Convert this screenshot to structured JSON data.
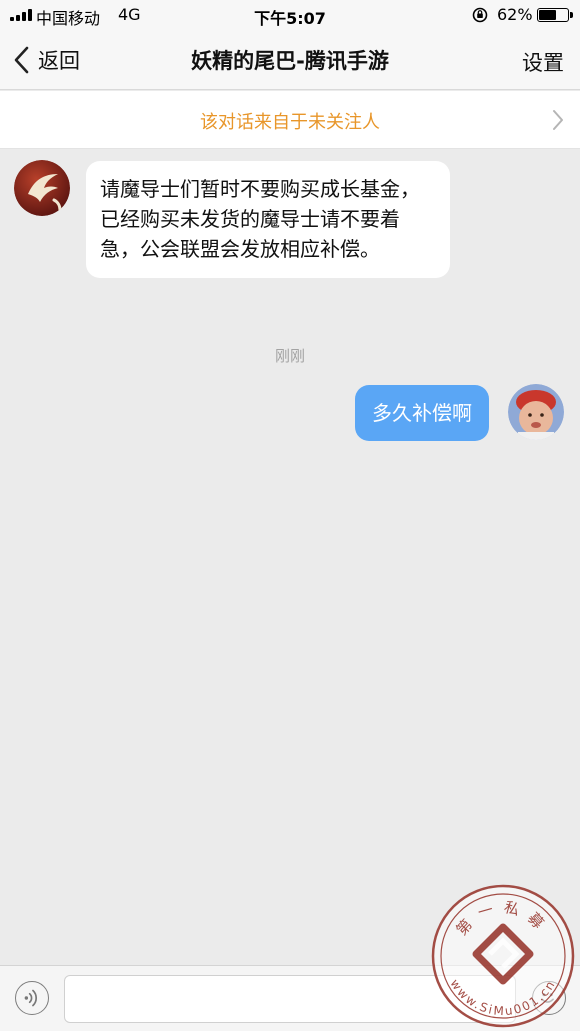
{
  "status_bar": {
    "carrier": "中国移动",
    "network": "4G",
    "time": "下午5:07",
    "battery_percent": "62%",
    "battery_level": 0.62
  },
  "nav": {
    "back_label": "返回",
    "title": "妖精的尾巴-腾讯手游",
    "settings_label": "设置"
  },
  "notice": {
    "text": "该对话来自于未关注人"
  },
  "messages": [
    {
      "direction": "incoming",
      "text": "请魔导士们暂时不要购买成长基金，已经购买未发货的魔导士请不要着急，公会联盟会发放相应补偿。"
    },
    {
      "direction": "outgoing",
      "text": "多久补偿啊"
    }
  ],
  "timestamp": "刚刚",
  "colors": {
    "accent_orange": "#e8962a",
    "outgoing_bubble": "#5aa6f5",
    "background": "#ebebeb"
  },
  "watermark": {
    "top_text": "第一私募",
    "bottom_text": "www.SiMu001.cn"
  }
}
